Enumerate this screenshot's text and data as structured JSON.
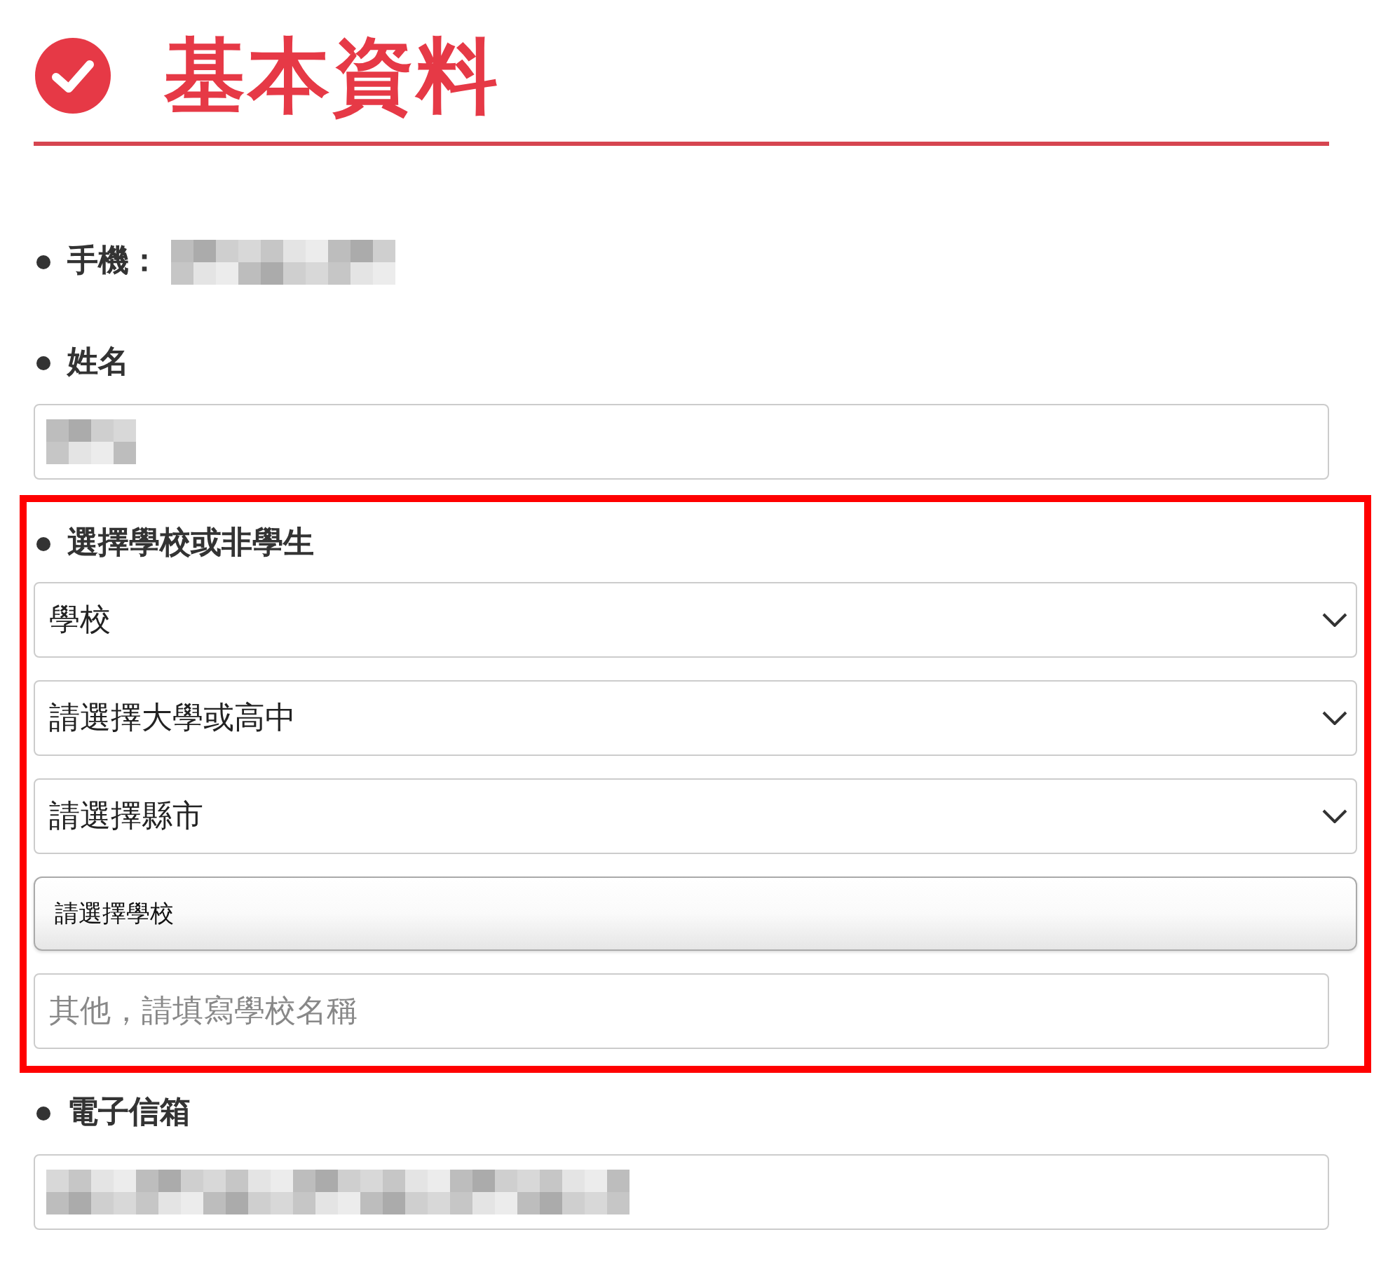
{
  "header": {
    "title": "基本資料"
  },
  "fields": [
    {
      "kind": "inline",
      "label": "手機：",
      "redacted": true
    },
    {
      "kind": "text",
      "label": "姓名",
      "redacted": true
    },
    {
      "kind": "group",
      "label": "選擇學校或非學生",
      "highlighted": true,
      "controls": [
        {
          "kind": "select",
          "value": "學校"
        },
        {
          "kind": "select",
          "value": "請選擇大學或高中"
        },
        {
          "kind": "select",
          "value": "請選擇縣市"
        },
        {
          "kind": "button",
          "label": "請選擇學校"
        },
        {
          "kind": "input",
          "placeholder": "其他，請填寫學校名稱"
        }
      ]
    },
    {
      "kind": "text",
      "label": "電子信箱",
      "redacted": true
    }
  ]
}
